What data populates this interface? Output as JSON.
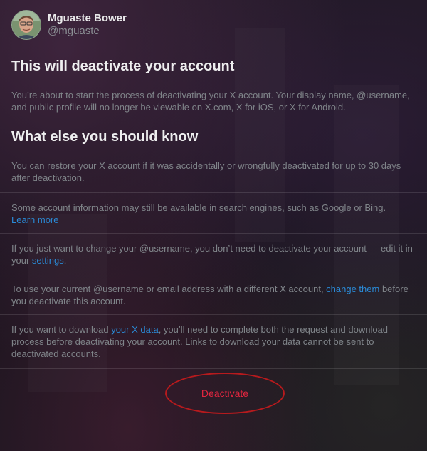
{
  "profile": {
    "display_name": "Mguaste Bower",
    "handle": "@mguaste_"
  },
  "heading_deactivate": "This will deactivate your account",
  "intro_text": "You’re about to start the process of deactivating your X account. Your display name, @username, and public profile will no longer be viewable on X.com, X for iOS, or X for Android.",
  "heading_know": "What else you should know",
  "items": [
    {
      "text": "You can restore your X account if it was accidentally or wrongfully deactivated for up to 30 days after deactivation."
    },
    {
      "text_before": "Some account information may still be available in search engines, such as Google or Bing.",
      "link": "Learn more"
    },
    {
      "text_before": "If you just want to change your @username, you don’t need to deactivate your account — edit it in your ",
      "link": "settings",
      "text_after": "."
    },
    {
      "text_before": "To use your current @username or email address with a different X account, ",
      "link": "change them",
      "text_after": " before you deactivate this account."
    },
    {
      "text_before": "If you want to download ",
      "link": "your X data",
      "text_after": ", you’ll need to complete both the request and download process before deactivating your account. Links to download your data cannot be sent to deactivated accounts."
    }
  ],
  "deactivate_label": "Deactivate",
  "colors": {
    "link": "#2a8ad6",
    "danger": "#e2263f",
    "highlight_circle": "#b81a1d"
  }
}
